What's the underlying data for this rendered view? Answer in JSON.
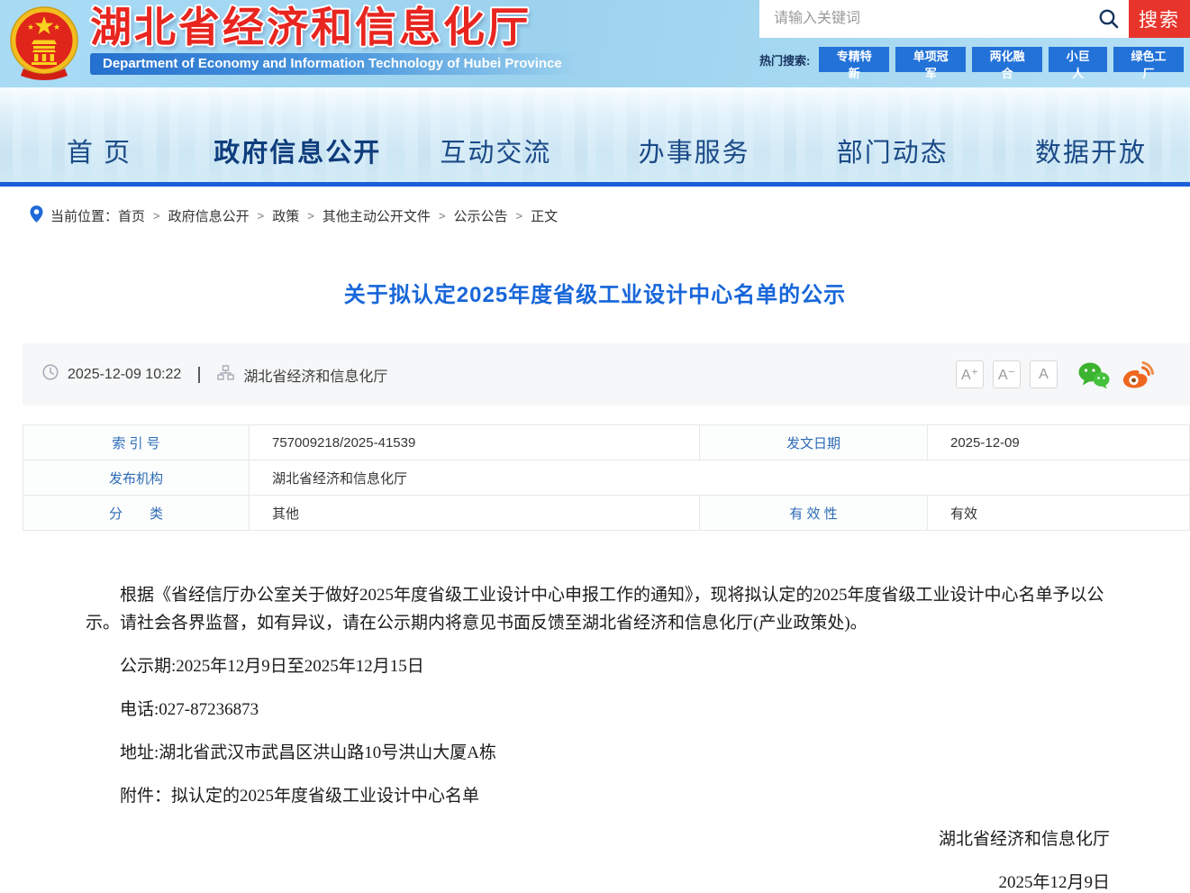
{
  "colors": {
    "header_red": "#e8251f",
    "search_button_red": "#e8352c",
    "hot_tag_blue": "#2272d8",
    "nav_border_blue": "#1a5fd7",
    "nav_text_blue": "#1b4a87",
    "title_blue": "#1766d9",
    "table_label_blue": "#2e6cb5",
    "wechat_green": "#3bb32f",
    "weibo_orange": "#ee6820"
  },
  "header": {
    "site_title": "湖北省经济和信息化厅",
    "site_subtitle": "Department of Economy and Information Technology of Hubei Province",
    "search": {
      "placeholder": "请输入关键词",
      "button_label": "搜索",
      "hot_label": "热门搜索:",
      "hot_tags": [
        "专精特新",
        "单项冠军",
        "两化融合",
        "小巨人",
        "绿色工厂"
      ]
    }
  },
  "nav": {
    "items": [
      {
        "label": "首 页"
      },
      {
        "label": "政府信息公开"
      },
      {
        "label": "互动交流"
      },
      {
        "label": "办事服务"
      },
      {
        "label": "部门动态"
      },
      {
        "label": "数据开放"
      }
    ]
  },
  "breadcrumb": {
    "label": "当前位置：",
    "separator": ">",
    "items": [
      "首页",
      "政府信息公开",
      "政策",
      "其他主动公开文件",
      "公示公告",
      "正文"
    ]
  },
  "article": {
    "title": "关于拟认定2025年度省级工业设计中心名单的公示",
    "meta": {
      "datetime": "2025-12-09 10:22",
      "source": "湖北省经济和信息化厅",
      "font_buttons": [
        "A⁺",
        "A⁻",
        "A"
      ]
    },
    "doc_table": {
      "r1": {
        "l1": "索 引 号",
        "v1": "757009218/2025-41539",
        "l2": "发文日期",
        "v2": "2025-12-09"
      },
      "r2": {
        "l1": "发布机构",
        "v1": "湖北省经济和信息化厅"
      },
      "r3": {
        "l1": "分　　类",
        "v1": "其他",
        "l2": "有 效 性",
        "v2": "有效"
      }
    },
    "body": {
      "paragraph": "根据《省经信厅办公室关于做好2025年度省级工业设计中心申报工作的通知》，现将拟认定的2025年度省级工业设计中心名单予以公示。请社会各界监督，如有异议，请在公示期内将意见书面反馈至湖北省经济和信息化厅(产业政策处)。",
      "lines": [
        "公示期:2025年12月9日至2025年12月15日",
        "电话:027-87236873",
        "地址:湖北省武汉市武昌区洪山路10号洪山大厦A栋"
      ],
      "attachment_label": "附件：",
      "attachment_name": "拟认定的2025年度省级工业设计中心名单",
      "signature_org": "湖北省经济和信息化厅",
      "signature_date": "2025年12月9日"
    }
  }
}
